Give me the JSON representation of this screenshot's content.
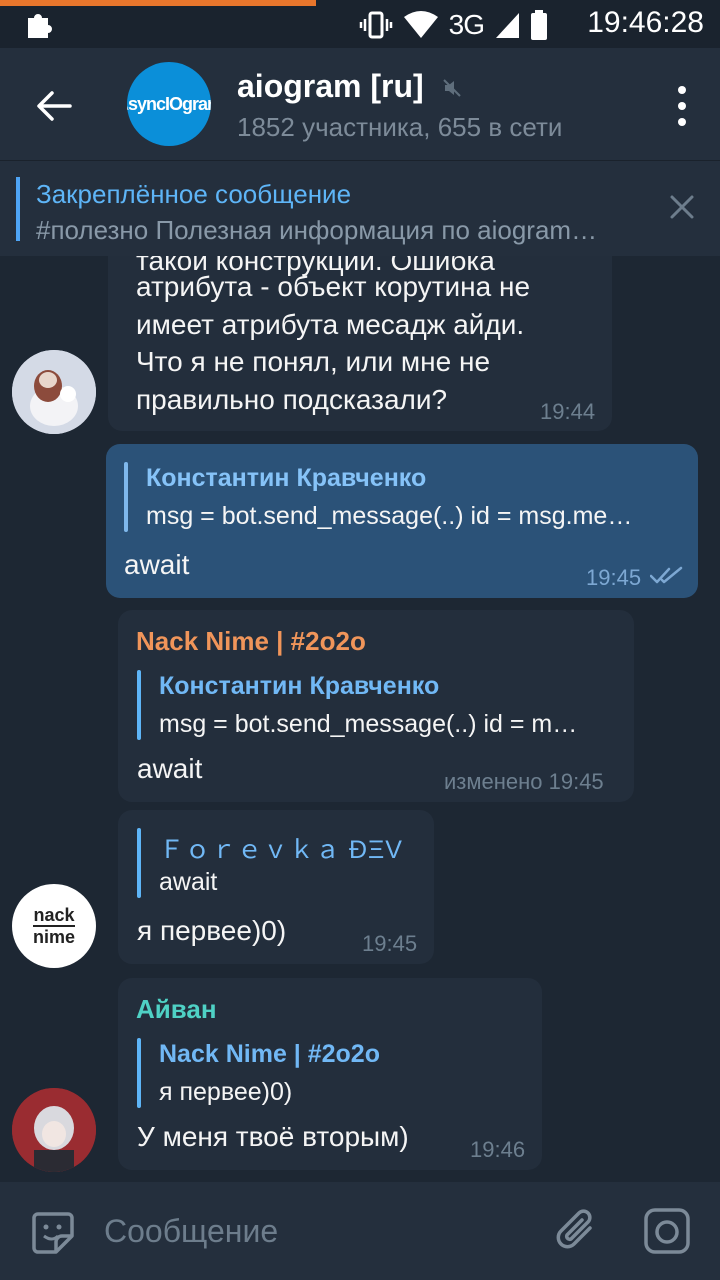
{
  "status_bar": {
    "network": "3G",
    "time": "19:46:28"
  },
  "header": {
    "title": "aiogram [ru]",
    "subtitle": "1852 участника, 655 в сети",
    "avatar_text": "AsyncIOgram"
  },
  "pinned": {
    "title": "Закреплённое сообщение",
    "text": "#полезно Полезная информация по aiogram…"
  },
  "messages": [
    {
      "lines": [
        "такой конструкции. Ошибка",
        "атрибута - объект корутина не",
        "имеет атрибута месадж айди.",
        "Что я не понял, или мне не",
        "правильно подсказали?"
      ],
      "time": "19:44"
    },
    {
      "reply_name": "Константин Кравченко",
      "reply_text": "msg = bot.send_message(..) id = msg.me…",
      "text": "await",
      "time": "19:45"
    },
    {
      "sender": "Nack Nime | #2o2o",
      "reply_name": "Константин Кравченко",
      "reply_text": "msg = bot.send_message(..) id = m…",
      "text": "await",
      "time": "изменено 19:45"
    },
    {
      "reply_name": "Ｆｏｒｅｖｋａ ĐΞV",
      "reply_text": "await",
      "text": "я первее)0)",
      "time": "19:45",
      "avatar_text_1": "nack",
      "avatar_text_2": "nime"
    },
    {
      "sender": "Айван",
      "reply_name": "Nack Nime | #2o2o",
      "reply_text": "я первее)0)",
      "text": "У меня твоё вторым)",
      "time": "19:46"
    }
  ],
  "input": {
    "placeholder": "Сообщение"
  },
  "colors": {
    "background": "#1d2733",
    "header": "#242f3d",
    "incoming_bubble": "#232e3c",
    "outgoing_bubble": "#2b5278",
    "link_blue": "#5eb5f7",
    "sender_orange": "#f0955a",
    "sender_teal": "#4fd1c5"
  },
  "icons": [
    "puzzle-icon",
    "vibrate-icon",
    "wifi-icon",
    "signal-icon",
    "battery-icon",
    "back-arrow-icon",
    "mute-icon",
    "more-vert-icon",
    "close-icon",
    "double-check-icon",
    "sticker-icon",
    "attach-icon",
    "camera-icon"
  ]
}
